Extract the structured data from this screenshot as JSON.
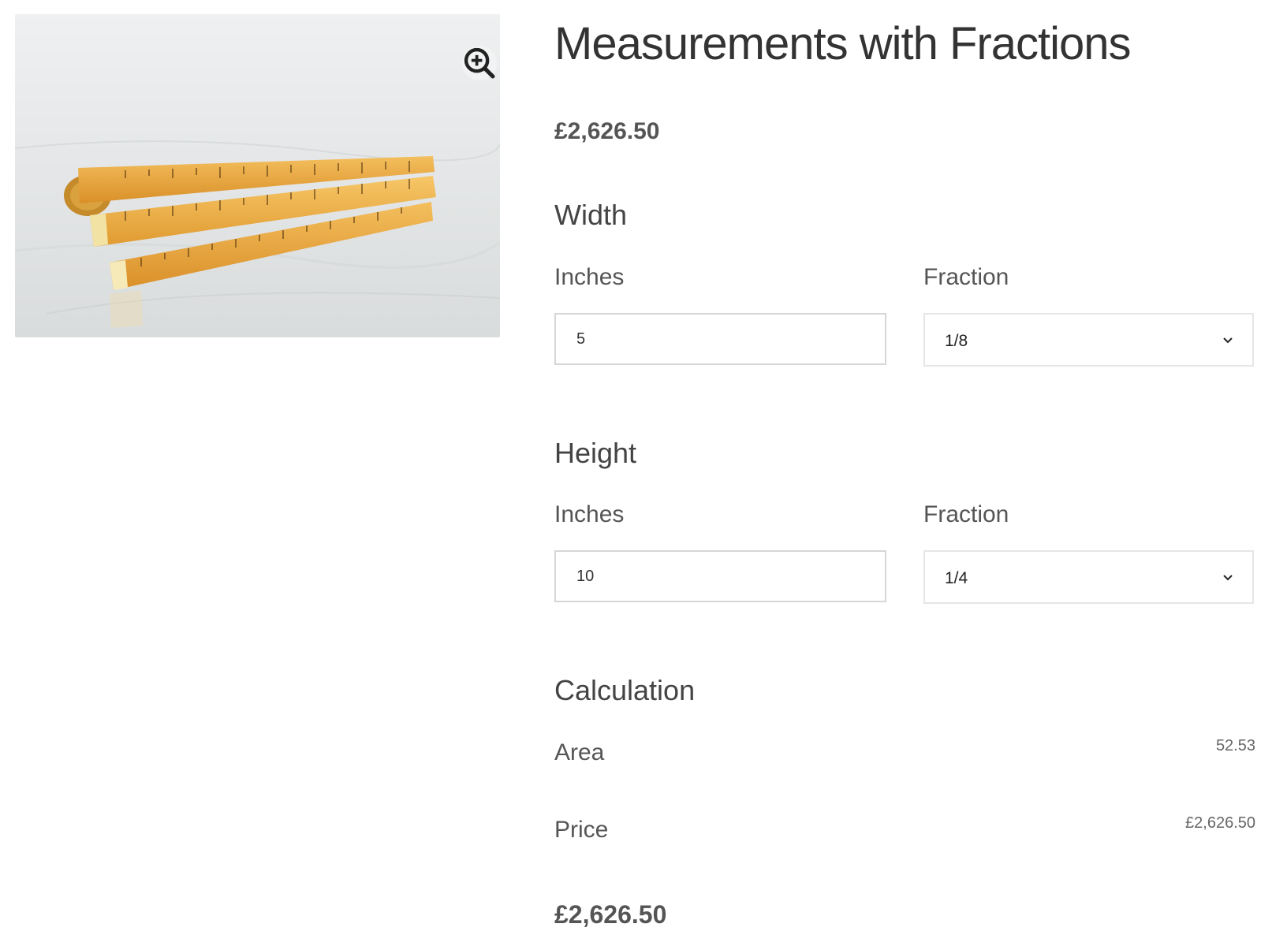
{
  "product": {
    "title": "Measurements with Fractions",
    "price": "£2,626.50",
    "image_alt": "folding-wooden-ruler"
  },
  "gallery": {
    "zoom_icon": "zoom-in-icon"
  },
  "width": {
    "heading": "Width",
    "inches_label": "Inches",
    "inches_value": "5",
    "fraction_label": "Fraction",
    "fraction_value": "1/8"
  },
  "height": {
    "heading": "Height",
    "inches_label": "Inches",
    "inches_value": "10",
    "fraction_label": "Fraction",
    "fraction_value": "1/4"
  },
  "calculation": {
    "heading": "Calculation",
    "area_label": "Area",
    "area_value": "52.53",
    "price_label": "Price",
    "price_value": "£2,626.50"
  },
  "total": {
    "price": "£2,626.50"
  },
  "colors": {
    "text_dark": "#333333",
    "text_muted": "#555555",
    "border": "#d6d6d6",
    "ruler_wood": "#e8a23c"
  }
}
